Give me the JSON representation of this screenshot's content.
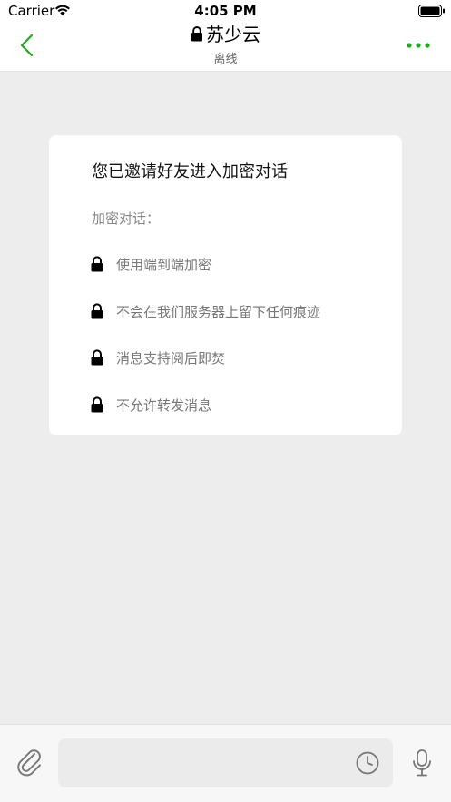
{
  "status_bar": {
    "carrier": "Carrier",
    "time": "4:05 PM"
  },
  "nav": {
    "title": "苏少云",
    "subtitle": "离线",
    "back_icon": "chevron-left-icon",
    "more_icon": "ellipsis-icon",
    "accent_color": "#1aad19"
  },
  "card": {
    "title": "您已邀请好友进入加密对话",
    "subhead": "加密对话：",
    "features": [
      "使用端到端加密",
      "不会在我们服务器上留下任何痕迹",
      "消息支持阅后即焚",
      "不允许转发消息"
    ]
  },
  "input_bar": {
    "placeholder": "",
    "attach_icon": "paperclip-icon",
    "timer_icon": "clock-icon",
    "mic_icon": "microphone-icon"
  }
}
